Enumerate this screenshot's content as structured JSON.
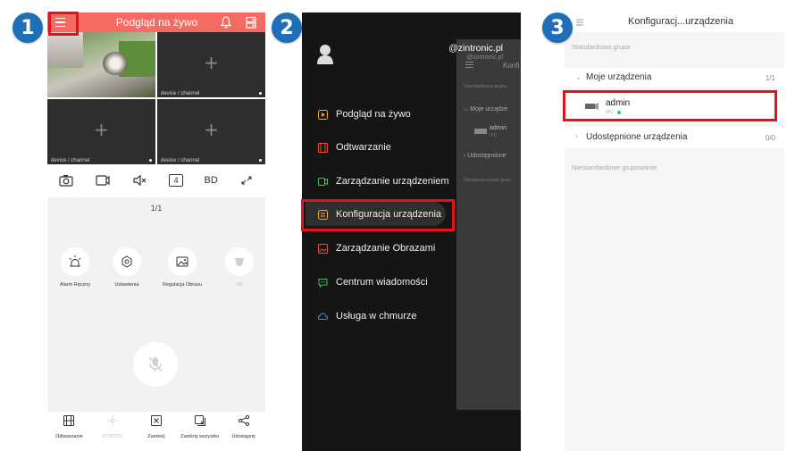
{
  "badges": [
    "1",
    "2",
    "3"
  ],
  "colors": {
    "accent": "#f56a62",
    "badge": "#1f6fb8",
    "highlight": "#e0141c",
    "online": "#3cc45a"
  },
  "panel1": {
    "title": "Podgląd na żywo",
    "icons": {
      "menu": "menu-icon",
      "bell": "bell-icon",
      "layout": "layout-icon"
    },
    "cells": [
      {
        "label": ""
      },
      {
        "label": "device / channel"
      },
      {
        "label": "device / channel"
      },
      {
        "label": "device / channel"
      }
    ],
    "plus": "+",
    "toolbar": {
      "channels": "4",
      "quality": "BD"
    },
    "page": "1/1",
    "controls": [
      {
        "label": "Alarm Ręczny",
        "icon": "alarm-icon"
      },
      {
        "label": "Ustawienia",
        "icon": "settings-icon"
      },
      {
        "label": "Regulacja Obrazu",
        "icon": "image-adjust-icon"
      },
      {
        "label": "VR",
        "icon": "vr-icon"
      }
    ],
    "bottom": [
      {
        "label": "Odtwarzanie"
      },
      {
        "label": "PTZ/VTC"
      },
      {
        "label": "Zamknij"
      },
      {
        "label": "Zamknij wszystko"
      },
      {
        "label": "Udostępnij"
      }
    ]
  },
  "panel2": {
    "user": "@zintronic.pl",
    "user_sub": "@zintronic.pl",
    "menu": [
      {
        "label": "Podgląd na żywo",
        "icon": "live-icon",
        "color": "#f5a623"
      },
      {
        "label": "Odtwarzanie",
        "icon": "playback-icon",
        "color": "#e8503a"
      },
      {
        "label": "Zarządzanie urządzeniem",
        "icon": "device-icon",
        "color": "#3cc45a"
      },
      {
        "label": "Konfiguracja urządzenia",
        "icon": "config-icon",
        "color": "#f5a623"
      },
      {
        "label": "Zarządzanie Obrazami",
        "icon": "images-icon",
        "color": "#e8503a"
      },
      {
        "label": "Centrum wiadomości",
        "icon": "message-icon",
        "color": "#3cc45a"
      },
      {
        "label": "Usługa w chmurze",
        "icon": "cloud-icon",
        "color": "#3a8ee8"
      }
    ],
    "behind": {
      "title": "Konfi",
      "group": "Standardowa grupa",
      "my_devices": "Moje urządze",
      "admin": "admin",
      "admin_sub": "IPC",
      "shared": "Udostępnione",
      "nonstd": "Niestandardowe grup"
    }
  },
  "panel3": {
    "title": "Konfiguracj...urządzenia",
    "group": "Standardowa grupa",
    "my_devices": "Moje urządzenia",
    "my_count": "1/1",
    "device_name": "admin",
    "device_type": "IPC",
    "shared": "Udostępnione urządzenia",
    "shared_count": "0/0",
    "nonstd": "Niestandardowe grupowanie"
  }
}
